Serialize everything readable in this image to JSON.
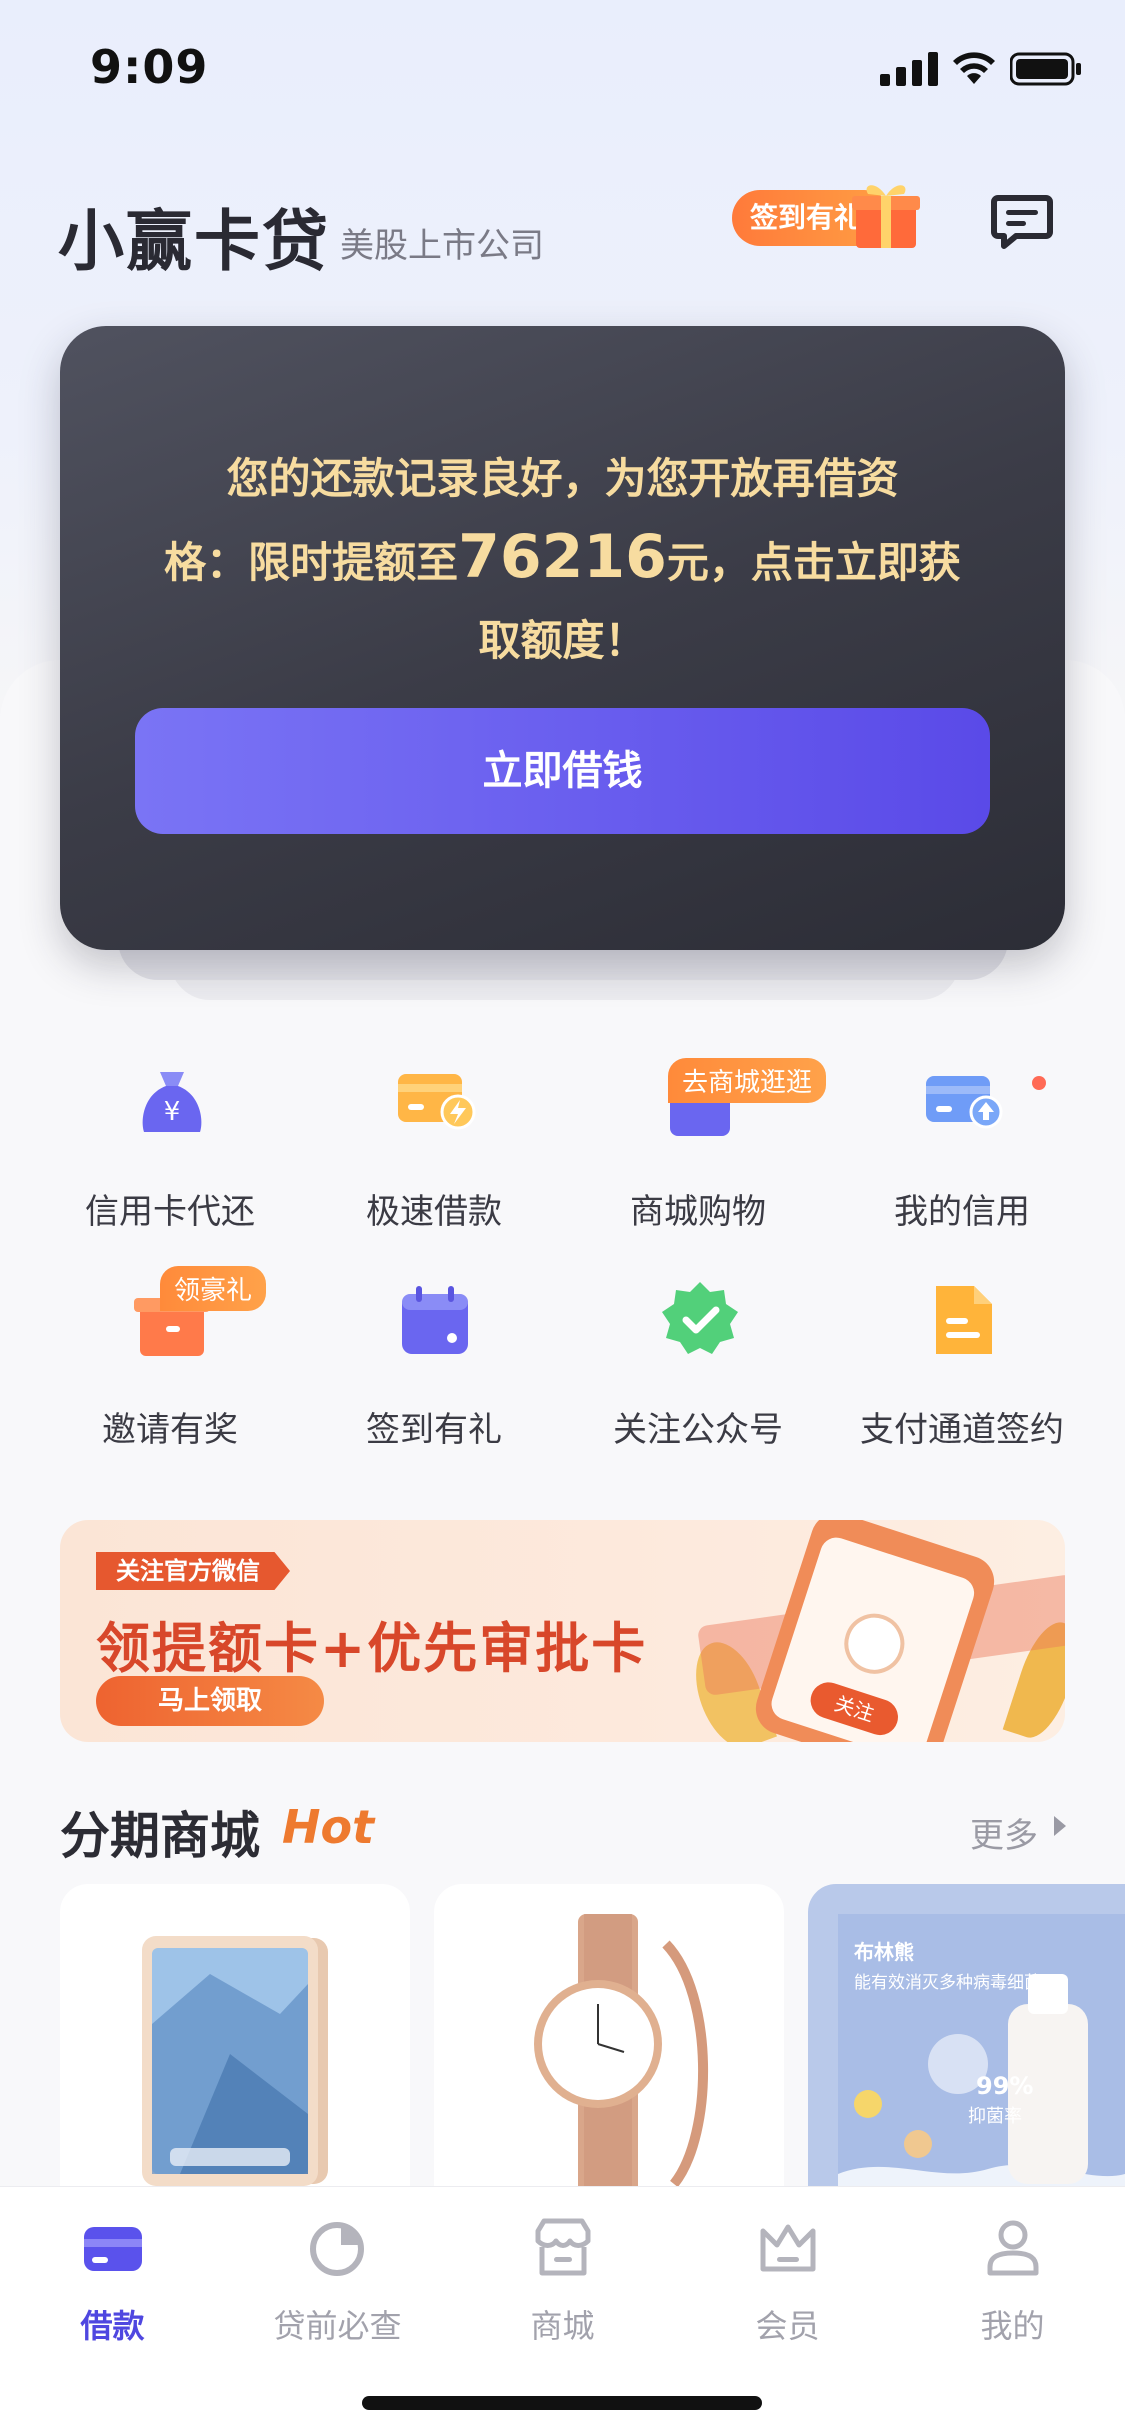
{
  "status_bar": {
    "time": "9:09"
  },
  "header": {
    "brand": "小赢卡贷",
    "brand_sub": "美股上市公司",
    "checkin_label": "签到有礼"
  },
  "promo_card": {
    "line1": "您的还款记录良好，为您开放再借资",
    "line2_pre": "格：限时提额至",
    "amount": "76216",
    "line2_post": "元，点击立即获",
    "line3": "取额度！",
    "button_label": "立即借钱"
  },
  "quick_grid": [
    {
      "label": "信用卡代还",
      "icon": "money-bag-icon"
    },
    {
      "label": "极速借款",
      "icon": "card-lightning-icon"
    },
    {
      "label": "商城购物",
      "icon": "shopping-bag-icon",
      "tag": "去商城逛逛"
    },
    {
      "label": "我的信用",
      "icon": "card-upload-icon",
      "dot": true
    },
    {
      "label": "邀请有奖",
      "icon": "gift-box-icon",
      "tag": "领豪礼"
    },
    {
      "label": "签到有礼",
      "icon": "calendar-icon"
    },
    {
      "label": "关注公众号",
      "icon": "verified-badge-icon"
    },
    {
      "label": "支付通道签约",
      "icon": "document-icon"
    }
  ],
  "banner": {
    "tag": "关注官方微信",
    "title": "领提额卡+优先审批卡",
    "button": "马上领取",
    "phone_button": "关注"
  },
  "mall_section": {
    "title": "分期商城",
    "hot": "Hot",
    "more": "更多",
    "products": [
      {
        "name": "tablet"
      },
      {
        "name": "watch"
      },
      {
        "name": "disinfectant-spray",
        "brand": "布林熊",
        "desc": "能有效消灭多种病毒细菌",
        "badge": "99%",
        "badge2": "抑菌率"
      }
    ]
  },
  "tab_bar": [
    {
      "label": "借款",
      "icon": "wallet-card-icon",
      "active": true
    },
    {
      "label": "贷前必查",
      "icon": "pie-chart-icon",
      "active": false
    },
    {
      "label": "商城",
      "icon": "store-icon",
      "active": false
    },
    {
      "label": "会员",
      "icon": "crown-icon",
      "active": false
    },
    {
      "label": "我的",
      "icon": "user-icon",
      "active": false
    }
  ],
  "colors": {
    "accent": "#4f47e0",
    "card_gold": "#f7dca0",
    "orange": "#ee7a2f"
  }
}
